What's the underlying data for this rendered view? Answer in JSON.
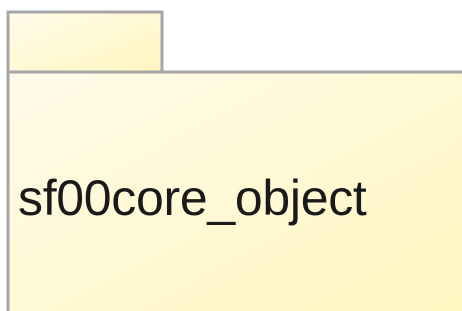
{
  "package": {
    "name": "sf00core_object",
    "fill_color": "#fffbd0",
    "border_color": "#9e9e9e"
  }
}
